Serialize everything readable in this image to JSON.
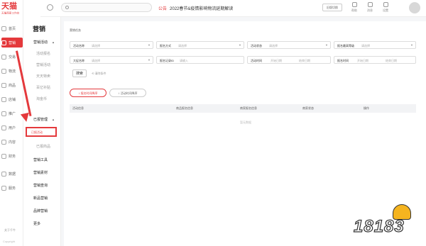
{
  "rail": {
    "logo": "天猫",
    "sub": "天猫商家工作台",
    "items": [
      {
        "label": "首页"
      },
      {
        "label": "营销",
        "active": true
      },
      {
        "label": "交易"
      },
      {
        "label": "物流"
      },
      {
        "label": "商品"
      },
      {
        "label": "店铺"
      },
      {
        "label": "推广"
      },
      {
        "label": "用户"
      },
      {
        "label": "内容"
      },
      {
        "label": "财务"
      },
      {
        "label": "数据"
      },
      {
        "label": "服务"
      }
    ],
    "foot": "关于千牛",
    "copyright": "Copyright"
  },
  "sidenav": {
    "title": "营销",
    "activity_group": "营销活动",
    "activity_items": [
      "活动报名",
      "营销活动",
      "天天特卖",
      "百亿补贴",
      "淘金币"
    ],
    "manage_group": "已报管理",
    "manage_items": [
      "已报活动",
      "已报商品"
    ],
    "more_items": [
      "营销工具",
      "营销素材",
      "营销查询",
      "新品营销",
      "品牌营销",
      "更多"
    ]
  },
  "topbar": {
    "notice_tag": "公告",
    "notice_text": "2022春节&疫情影响物流延期解读",
    "button": "旧版切换",
    "icons": [
      {
        "name": "help-icon",
        "label": "帮助"
      },
      {
        "name": "message-icon",
        "label": "消息"
      },
      {
        "name": "settings-icon",
        "label": "设置"
      }
    ]
  },
  "main": {
    "section_label": "营销任务",
    "filters": [
      {
        "label": "活动名称",
        "placeholder": "请选择"
      },
      {
        "label": "报名方式",
        "placeholder": "请选择"
      },
      {
        "label": "活动状态",
        "placeholder": "请选择"
      },
      {
        "label": "报名最高等级",
        "placeholder": "请选择"
      },
      {
        "label": "大促名称",
        "placeholder": "请选择"
      },
      {
        "label": "报名记录ID",
        "placeholder": "请输入"
      },
      {
        "label": "活动时间",
        "placeholder": "开始日期",
        "placeholder2": "结束日期"
      },
      {
        "label": "报名时间",
        "placeholder": "开始日期",
        "placeholder2": "结束日期"
      }
    ],
    "search_button": "搜索",
    "reset": "清除条件",
    "sort_buttons": [
      "报名时间降序",
      "活动时间降序"
    ],
    "columns": [
      "活动信息",
      "商品报名信息",
      "商家报名信息",
      "商家状态",
      "操作"
    ],
    "empty": "暂无数据"
  },
  "watermark": {
    "text": "18183"
  },
  "colors": {
    "accent": "#e4393c"
  }
}
